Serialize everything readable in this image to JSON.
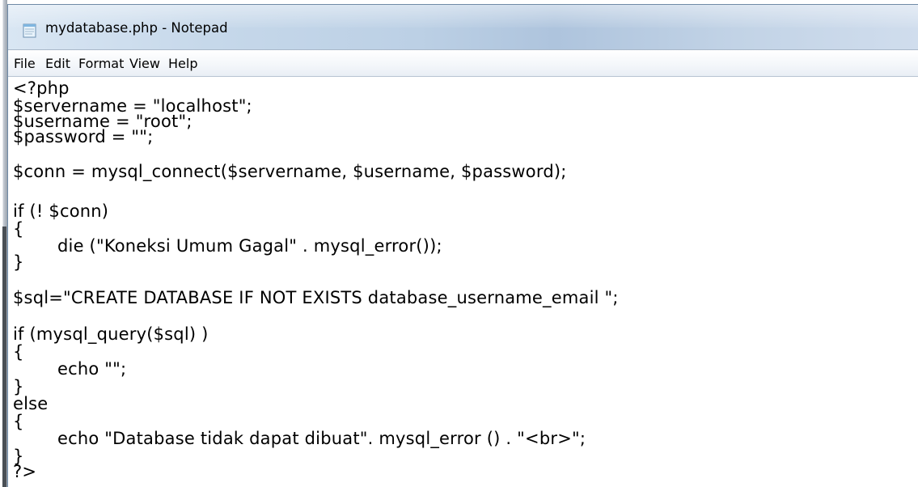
{
  "window": {
    "title": "mydatabase.php - Notepad",
    "icon": "notepad-icon"
  },
  "menu": {
    "items": [
      "File",
      "Edit",
      "Format",
      "View",
      "Help"
    ]
  },
  "editor": {
    "lines": [
      "<?php",
      "$servername = \"localhost\";",
      "$username = \"root\";",
      "$password = \"\";",
      "$conn = mysql_connect($servername, $username, $password);",
      "if (! $conn)",
      "{",
      "        die (\"Koneksi Umum Gagal\" . mysql_error());",
      "}",
      "$sql=\"CREATE DATABASE IF NOT EXISTS database_username_email \";",
      "if (mysql_query($sql) )",
      "{",
      "        echo \"\";",
      "}",
      "else",
      "{",
      "        echo \"Database tidak dapat dibuat\". mysql_error () . \"<br>\";",
      "}",
      "?>"
    ]
  }
}
